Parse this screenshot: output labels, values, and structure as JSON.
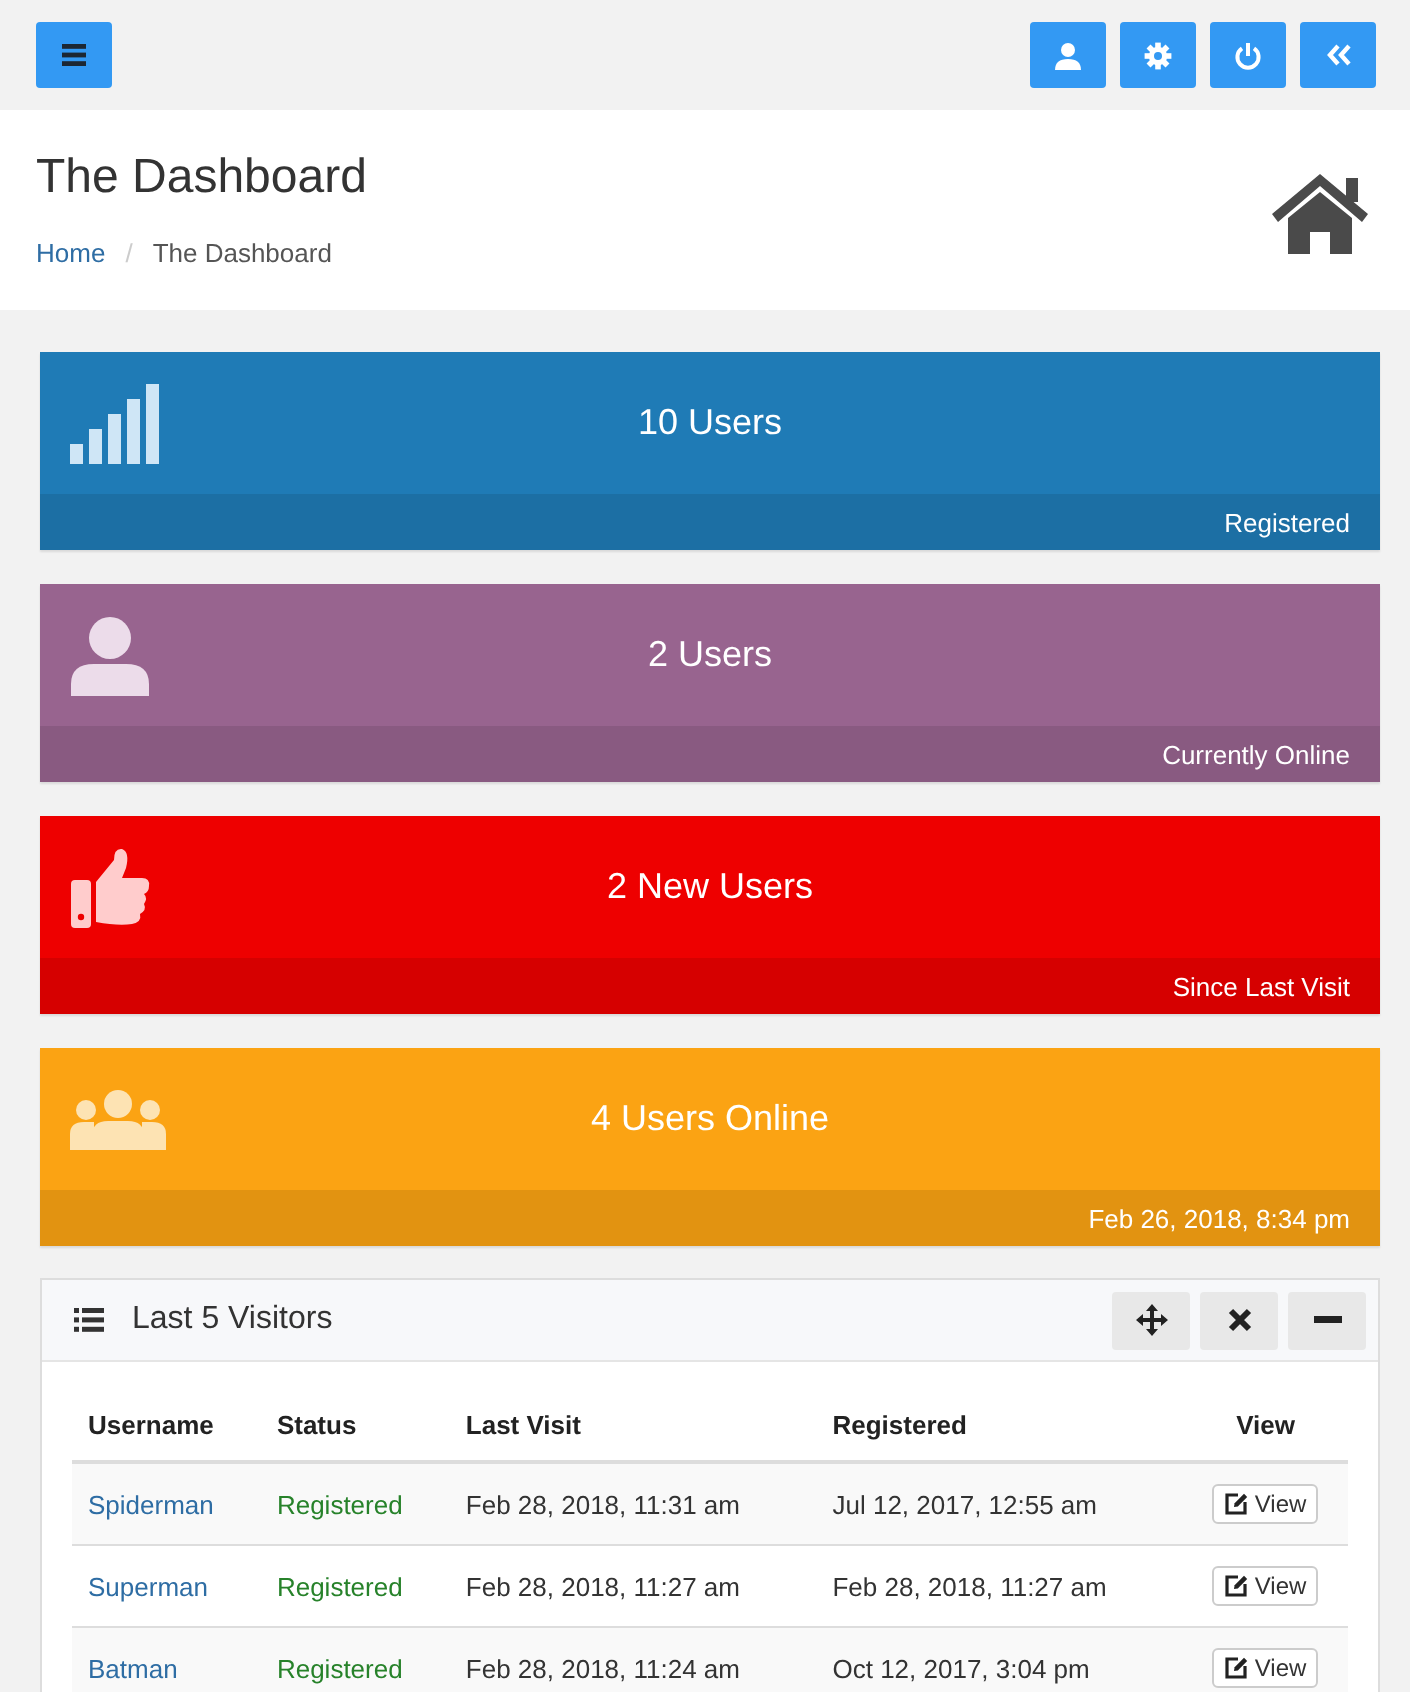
{
  "topbar": {
    "buttons": [
      {
        "kind": "user"
      },
      {
        "kind": "gear"
      },
      {
        "kind": "power"
      },
      {
        "kind": "collapse"
      }
    ]
  },
  "header": {
    "title": "The Dashboard",
    "breadcrumb": [
      {
        "label": "Home",
        "link": true
      },
      {
        "label": "The Dashboard",
        "link": false,
        "separator": "/"
      }
    ]
  },
  "stat_cards": [
    {
      "kind": "signal",
      "value": "10 Users",
      "footer": "Registered",
      "color": "#1f7bb6"
    },
    {
      "kind": "user",
      "value": "2 Users",
      "footer": "Currently Online",
      "color": "#98648f"
    },
    {
      "kind": "thumbs",
      "value": "2 New Users",
      "footer": "Since Last Visit",
      "color": "#ee0000"
    },
    {
      "kind": "users",
      "value": "4 Users Online",
      "footer": "Feb 26, 2018, 8:34 pm",
      "color": "#fba313"
    }
  ],
  "panel": {
    "title": "Last 5 Visitors",
    "tools": [
      {
        "kind": "move"
      },
      {
        "kind": "close"
      },
      {
        "kind": "minimize"
      }
    ],
    "table": {
      "columns": [
        "Username",
        "Status",
        "Last Visit",
        "Registered",
        "View"
      ],
      "rows": [
        {
          "username": "Spiderman",
          "status": "Registered",
          "last_visit": "Feb 28, 2018, 11:31 am",
          "registered": "Jul 12, 2017, 12:55 am",
          "action": "View"
        },
        {
          "username": "Superman",
          "status": "Registered",
          "last_visit": "Feb 28, 2018, 11:27 am",
          "registered": "Feb 28, 2018, 11:27 am",
          "action": "View"
        },
        {
          "username": "Batman",
          "status": "Registered",
          "last_visit": "Feb 28, 2018, 11:24 am",
          "registered": "Oct 12, 2017, 3:04 pm",
          "action": "View"
        }
      ]
    }
  }
}
